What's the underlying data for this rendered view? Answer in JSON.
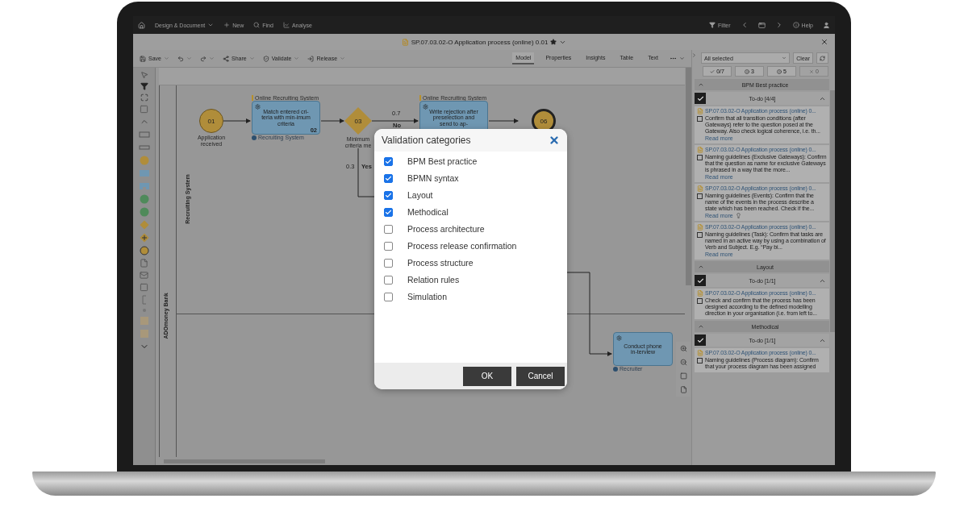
{
  "nav": {
    "menus": [
      "Design & Document",
      "New",
      "Find",
      "Analyse"
    ],
    "filter": "Filter",
    "help": "Help"
  },
  "title": {
    "text": "SP.07.03.02-O Application process (online) 0.01",
    "favorite": true
  },
  "toolbar": {
    "actions": [
      {
        "kind": "save",
        "label": "Save"
      },
      {
        "kind": "undo"
      },
      {
        "kind": "redo"
      },
      {
        "kind": "share",
        "label": "Share"
      },
      {
        "kind": "validate",
        "label": "Validate"
      },
      {
        "kind": "release",
        "label": "Release"
      }
    ],
    "views": [
      {
        "label": "Model",
        "selected": true
      },
      {
        "label": "Properties",
        "selected": false
      },
      {
        "label": "Insights",
        "selected": false
      },
      {
        "label": "Table",
        "selected": false
      },
      {
        "label": "Text",
        "selected": false
      }
    ]
  },
  "diagram": {
    "pool": "ADOmoney Bank",
    "lane": "Recruiting System",
    "nodes": [
      {
        "kind": "start_event",
        "number": "01",
        "label": "Application received"
      },
      {
        "kind": "task",
        "number": "02",
        "label": "Match entered cri-teria with min-imum criteria",
        "annotation": "Online Recruiting System",
        "performer": "Recruiting System"
      },
      {
        "kind": "gateway",
        "number": "03",
        "label": "Minimum criteria me"
      },
      {
        "kind": "task",
        "label": "Write rejection after preselection and send to ap-",
        "annotation": "Online Recruiting System"
      },
      {
        "kind": "end_event",
        "number": "06"
      },
      {
        "kind": "task",
        "label": "Conduct phone in-terview",
        "performer": "Recruiter"
      }
    ],
    "edge_labels": [
      "0.7",
      "No",
      "0.3",
      "Yes"
    ]
  },
  "dialog": {
    "title": "Validation categories",
    "categories": [
      {
        "label": "BPM Best practice",
        "checked": true
      },
      {
        "label": "BPMN syntax",
        "checked": true
      },
      {
        "label": "Layout",
        "checked": true
      },
      {
        "label": "Methodical",
        "checked": true
      },
      {
        "label": "Process architecture",
        "checked": false
      },
      {
        "label": "Process release confirmation",
        "checked": false
      },
      {
        "label": "Process structure",
        "checked": false
      },
      {
        "label": "Relation rules",
        "checked": false
      },
      {
        "label": "Simulation",
        "checked": false
      }
    ],
    "buttons": [
      "OK",
      "Cancel"
    ]
  },
  "panel": {
    "filter": "All selected",
    "clear": "Clear",
    "counters": [
      {
        "kind": "done",
        "count": "0/7",
        "disabled": false
      },
      {
        "kind": "info",
        "count": "3",
        "disabled": false
      },
      {
        "kind": "warning",
        "count": "5",
        "disabled": false
      },
      {
        "kind": "error",
        "count": "0",
        "disabled": true
      }
    ],
    "groups": [
      {
        "title": "BPM Best practice",
        "expanded": true,
        "todo": {
          "label": "To-do [4/4]",
          "checked": true,
          "expanded": true
        },
        "items": [
          {
            "model": "SP.07.03.02-O Application process (online) 0...",
            "text": "Confirm that all transition conditions (after Gateways) refer to the question posed at the Gateway. Also check logical coherence, i.e. th...",
            "read_more": "Read more",
            "hint": false,
            "checked": false
          },
          {
            "model": "SP.07.03.02-O Application process (online) 0...",
            "text": "Naming guidelines (Exclusive Gateways): Confirm that the question as name for exclusive Gateways is phrased in a way that the more...",
            "read_more": "Read more",
            "hint": false,
            "checked": false
          },
          {
            "model": "SP.07.03.02-O Application process (online) 0...",
            "text": "Naming guidelines (Events): Confirm that the name of the events in the process describe a state which has been reached. Check if the...",
            "read_more": "Read more",
            "hint": true,
            "checked": false
          },
          {
            "model": "SP.07.03.02-O Application process (online) 0...",
            "text": "Naming guidelines (Task): Confirm that tasks are named in an active way by using a combination of Verb and Subject. E.g. “Pay bi...",
            "read_more": "Read more",
            "hint": false,
            "checked": false
          }
        ]
      },
      {
        "title": "Layout",
        "expanded": true,
        "todo": {
          "label": "To-do [1/1]",
          "checked": true,
          "expanded": true
        },
        "items": [
          {
            "model": "SP.07.03.02-O Application process (online) 0...",
            "text": "Check and confirm that the process has been designed according to the defined modelling direction in your organisation (i.e. from left to...",
            "hint": false,
            "checked": false
          }
        ]
      },
      {
        "title": "Methodical",
        "expanded": true,
        "todo": {
          "label": "To-do [1/1]",
          "checked": true,
          "expanded": true
        },
        "items": [
          {
            "model": "SP.07.03.02-O Application process (online) 0...",
            "text": "Naming guidelines (Process diagram): Confirm that your process diagram has been assigned",
            "hint": false,
            "checked": false
          }
        ]
      }
    ]
  }
}
